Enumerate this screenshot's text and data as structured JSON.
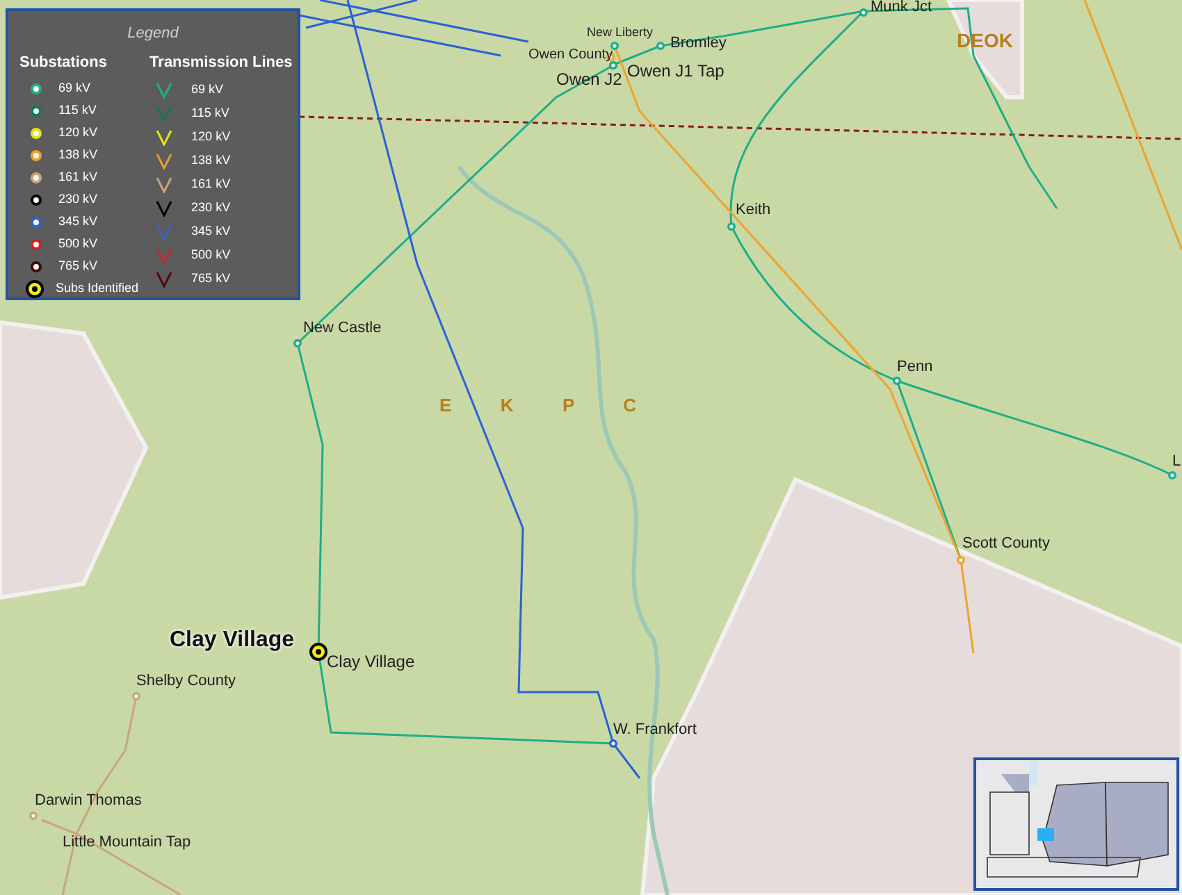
{
  "legend": {
    "title": "Legend",
    "substations_heading": "Substations",
    "lines_heading": "Transmission Lines",
    "substations": [
      {
        "label": "69 kV",
        "color": "#1fae86"
      },
      {
        "label": "115 kV",
        "color": "#0e7a55"
      },
      {
        "label": "120 kV",
        "color": "#e6e21c"
      },
      {
        "label": "138 kV",
        "color": "#f0a22c"
      },
      {
        "label": "161 kV",
        "color": "#c9a57a"
      },
      {
        "label": "230 kV",
        "color": "#000000"
      },
      {
        "label": "345 kV",
        "color": "#2a62d4"
      },
      {
        "label": "500 kV",
        "color": "#d42222"
      },
      {
        "label": "765 kV",
        "color": "#3a0a0a"
      }
    ],
    "identified": {
      "label": "Subs Identified",
      "color": "#f2ee10"
    },
    "lines": [
      {
        "label": "69 kV",
        "color": "#1fae86"
      },
      {
        "label": "115 kV",
        "color": "#0e7a55"
      },
      {
        "label": "120 kV",
        "color": "#e6e21c"
      },
      {
        "label": "138 kV",
        "color": "#e0a030"
      },
      {
        "label": "161 kV",
        "color": "#c9a57a"
      },
      {
        "label": "230 kV",
        "color": "#000000"
      },
      {
        "label": "345 kV",
        "color": "#3a62c4"
      },
      {
        "label": "500 kV",
        "color": "#c42828"
      },
      {
        "label": "765 kV",
        "color": "#4a0a0a"
      }
    ]
  },
  "map": {
    "regions": [
      {
        "label": "DEOK"
      },
      {
        "label": "E  K  P  C"
      }
    ],
    "substations": [
      {
        "name": "Munk Jct",
        "color": "#1fae86"
      },
      {
        "name": "New Liberty",
        "color": "#1fae86"
      },
      {
        "name": "Bromley",
        "color": "#1fae86"
      },
      {
        "name": "Owen County",
        "color": "#f0a22c"
      },
      {
        "name": "Owen J2",
        "color": "#1fae86"
      },
      {
        "name": "Owen J1 Tap",
        "color": "#1fae86"
      },
      {
        "name": "Keith",
        "color": "#1fae86"
      },
      {
        "name": "New Castle",
        "color": "#1fae86"
      },
      {
        "name": "Penn",
        "color": "#1fae86"
      },
      {
        "name": "L",
        "color": "#1fae86"
      },
      {
        "name": "Scott County",
        "color": "#f0a22c"
      },
      {
        "name": "Clay Village",
        "identified": true,
        "highlight_label": "Clay Village"
      },
      {
        "name": "Shelby County",
        "color": "#c9a57a"
      },
      {
        "name": "W. Frankfort",
        "color": "#2a62d4"
      },
      {
        "name": "Darwin Thomas",
        "color": "#c9a57a"
      },
      {
        "name": "Little Mountain Tap"
      }
    ]
  }
}
